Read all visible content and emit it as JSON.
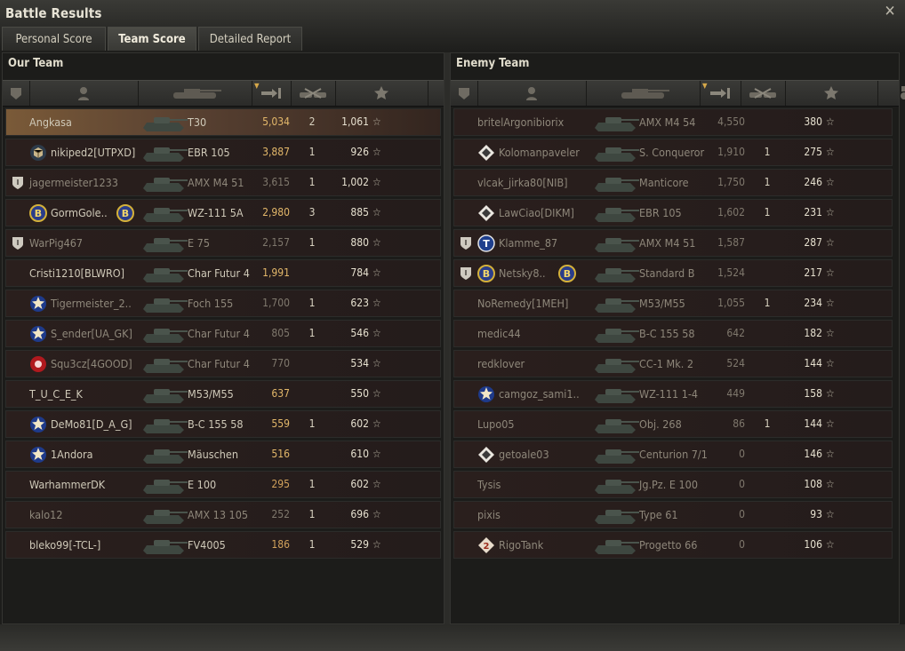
{
  "window": {
    "title": "Battle Results",
    "close_icon": "close-icon"
  },
  "tabs": [
    {
      "label": "Personal Score",
      "active": false
    },
    {
      "label": "Team Score",
      "active": true
    },
    {
      "label": "Detailed Report",
      "active": false
    }
  ],
  "our_team": {
    "title": "Our Team",
    "rows": [
      {
        "name": "Angkasa",
        "vehicle": "T30",
        "damage": "5,034",
        "kills": "2",
        "xp": "1,061",
        "badge": "",
        "clan": "",
        "self": true,
        "alive": true
      },
      {
        "name": "nikiped2[UTPXD]",
        "vehicle": "EBR 105",
        "damage": "3,887",
        "kills": "1",
        "xp": "926",
        "badge": "",
        "clan": "cube-emblem",
        "self": false,
        "alive": true
      },
      {
        "name": "jagermeister1233",
        "vehicle": "AMX M4 51",
        "damage": "3,615",
        "kills": "1",
        "xp": "1,002",
        "badge": "shield",
        "clan": "",
        "self": false,
        "alive": false
      },
      {
        "name": "GormGole..",
        "vehicle": "WZ-111 5A",
        "damage": "2,980",
        "kills": "3",
        "xp": "885",
        "badge": "",
        "clan": "b-emblem",
        "self": false,
        "alive": true,
        "extra_emblem": true
      },
      {
        "name": "WarPig467",
        "vehicle": "E 75",
        "damage": "2,157",
        "kills": "1",
        "xp": "880",
        "badge": "shield",
        "clan": "",
        "self": false,
        "alive": false
      },
      {
        "name": "Cristi1210[BLWRO]",
        "vehicle": "Char Futur 4",
        "damage": "1,991",
        "kills": "",
        "xp": "784",
        "badge": "",
        "clan": "",
        "self": false,
        "alive": true
      },
      {
        "name": "Tigermeister_2..",
        "vehicle": "Foch 155",
        "damage": "1,700",
        "kills": "1",
        "xp": "623",
        "badge": "",
        "clan": "star-emblem",
        "self": false,
        "alive": false
      },
      {
        "name": "S_ender[UA_GK]",
        "vehicle": "Char Futur 4",
        "damage": "805",
        "kills": "1",
        "xp": "546",
        "badge": "",
        "clan": "star-emblem",
        "self": false,
        "alive": false
      },
      {
        "name": "Squ3cz[4GOOD]",
        "vehicle": "Char Futur 4",
        "damage": "770",
        "kills": "",
        "xp": "534",
        "badge": "",
        "clan": "red-emblem",
        "self": false,
        "alive": false
      },
      {
        "name": "T_U_C_E_K",
        "vehicle": "M53/M55",
        "damage": "637",
        "kills": "",
        "xp": "550",
        "badge": "",
        "clan": "",
        "self": false,
        "alive": true
      },
      {
        "name": "DeMo81[D_A_G]",
        "vehicle": "B-C 155 58",
        "damage": "559",
        "kills": "1",
        "xp": "602",
        "badge": "",
        "clan": "star-emblem",
        "self": false,
        "alive": true
      },
      {
        "name": "1Andora",
        "vehicle": "Mäuschen",
        "damage": "516",
        "kills": "",
        "xp": "610",
        "badge": "",
        "clan": "star-emblem",
        "self": false,
        "alive": true
      },
      {
        "name": "WarhammerDK",
        "vehicle": "E 100",
        "damage": "295",
        "kills": "1",
        "xp": "602",
        "badge": "",
        "clan": "",
        "self": false,
        "alive": true
      },
      {
        "name": "kalo12",
        "vehicle": "AMX 13 105",
        "damage": "252",
        "kills": "1",
        "xp": "696",
        "badge": "",
        "clan": "",
        "self": false,
        "alive": false
      },
      {
        "name": "bleko99[-TCL-]",
        "vehicle": "FV4005",
        "damage": "186",
        "kills": "1",
        "xp": "529",
        "badge": "",
        "clan": "",
        "self": false,
        "alive": true
      }
    ]
  },
  "enemy_team": {
    "title": "Enemy Team",
    "rows": [
      {
        "name": "britelArgonibiorix",
        "vehicle": "AMX M4 54",
        "damage": "4,550",
        "kills": "",
        "xp": "380",
        "badge": "",
        "clan": "",
        "alive": false
      },
      {
        "name": "Kolomanpaveler",
        "vehicle": "S. Conqueror",
        "damage": "1,910",
        "kills": "1",
        "xp": "275",
        "badge": "",
        "clan": "diamond-emblem",
        "alive": false
      },
      {
        "name": "vlcak_jirka80[NIB]",
        "vehicle": "Manticore",
        "damage": "1,750",
        "kills": "1",
        "xp": "246",
        "badge": "",
        "clan": "",
        "alive": false
      },
      {
        "name": "LawCiao[DIKM]",
        "vehicle": "EBR 105",
        "damage": "1,602",
        "kills": "1",
        "xp": "231",
        "badge": "",
        "clan": "diamond-emblem",
        "alive": false
      },
      {
        "name": "Klamme_87",
        "vehicle": "AMX M4 51",
        "damage": "1,587",
        "kills": "",
        "xp": "287",
        "badge": "shield",
        "clan": "t-emblem",
        "alive": false
      },
      {
        "name": "Netsky8..",
        "vehicle": "Standard B",
        "damage": "1,524",
        "kills": "",
        "xp": "217",
        "badge": "shield",
        "clan": "b-emblem",
        "alive": false,
        "extra_emblem": true
      },
      {
        "name": "NoRemedy[1MEH]",
        "vehicle": "M53/M55",
        "damage": "1,055",
        "kills": "1",
        "xp": "234",
        "badge": "",
        "clan": "",
        "alive": false
      },
      {
        "name": "medic44",
        "vehicle": "B-C 155 58",
        "damage": "642",
        "kills": "",
        "xp": "182",
        "badge": "",
        "clan": "",
        "alive": false
      },
      {
        "name": "redklover",
        "vehicle": "CC-1 Mk. 2",
        "damage": "524",
        "kills": "",
        "xp": "144",
        "badge": "",
        "clan": "",
        "alive": false
      },
      {
        "name": "camgoz_sami1..",
        "vehicle": "WZ-111 1-4",
        "damage": "449",
        "kills": "",
        "xp": "158",
        "badge": "",
        "clan": "star-emblem",
        "alive": false
      },
      {
        "name": "Lupo05",
        "vehicle": "Obj. 268",
        "damage": "86",
        "kills": "1",
        "xp": "144",
        "badge": "",
        "clan": "",
        "alive": false
      },
      {
        "name": "getoale03",
        "vehicle": "Centurion 7/1",
        "damage": "0",
        "kills": "",
        "xp": "146",
        "badge": "",
        "clan": "diamond-emblem",
        "alive": false
      },
      {
        "name": "Tysis",
        "vehicle": "Jg.Pz. E 100",
        "damage": "0",
        "kills": "",
        "xp": "108",
        "badge": "",
        "clan": "",
        "alive": false
      },
      {
        "name": "pixis",
        "vehicle": "Type 61",
        "damage": "0",
        "kills": "",
        "xp": "93",
        "badge": "",
        "clan": "",
        "alive": false
      },
      {
        "name": "RigoTank",
        "vehicle": "Progetto 66",
        "damage": "0",
        "kills": "",
        "xp": "106",
        "badge": "",
        "clan": "rank2-emblem",
        "alive": false
      }
    ]
  },
  "columns": {
    "squad": "squad-icon",
    "player": "player-icon",
    "vehicle": "tank-icon",
    "damage": "damage-icon",
    "kills": "kills-icon",
    "xp": "star-icon",
    "medal": "medal-icon"
  },
  "colors": {
    "accent": "#e2b76a",
    "self_row": "#7a5a38"
  }
}
